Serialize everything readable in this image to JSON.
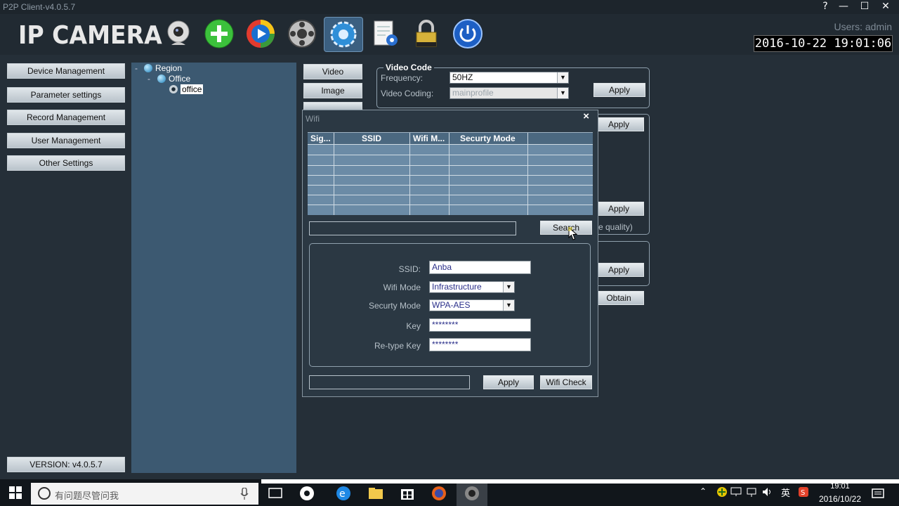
{
  "window": {
    "title": "P2P Client-v4.0.5.7",
    "controls": [
      "?",
      "—",
      "☐",
      "✕"
    ]
  },
  "header": {
    "logo": "IP CAMERA",
    "toolbar_icons": [
      "webcam-icon",
      "add-icon",
      "playback-icon",
      "ptz-wheel-icon",
      "settings-gear-icon",
      "log-icon",
      "lock-icon",
      "power-icon"
    ],
    "active_tool": "settings-gear-icon",
    "users": "Users: admin",
    "datetime": "2016-10-22 19:01:06"
  },
  "sidebar": {
    "items": [
      {
        "label": "Device Management"
      },
      {
        "label": "Parameter settings"
      },
      {
        "label": "Record Management"
      },
      {
        "label": "User Management"
      },
      {
        "label": "Other Settings"
      }
    ],
    "version": "VERSION: v4.0.5.7"
  },
  "tree": {
    "toggles": [
      "-",
      "-"
    ],
    "nodes": [
      {
        "label": "Region"
      },
      {
        "label": "Office"
      },
      {
        "label": "office",
        "selected": true
      }
    ]
  },
  "param_tabs": [
    "Video",
    "Image"
  ],
  "video_code": {
    "title": "Video Code",
    "frequency_label": "Frequency:",
    "frequency_value": "50HZ",
    "coding_label": "Video Coding:",
    "coding_value": "mainprofile",
    "apply": "Apply"
  },
  "background_panel": {
    "apply_buttons": [
      "Apply",
      "Apply",
      "Apply"
    ],
    "quality_fragment": "e quality)",
    "obtain": "Obtain"
  },
  "wifi_dialog": {
    "caption": "Wifi",
    "close": "×",
    "columns": [
      "Sig...",
      "SSID",
      "Wifi M...",
      "Securty Mode"
    ],
    "search_button": "Search",
    "ssid_label": "SSID:",
    "ssid_value": "Anba",
    "wifi_mode_label": "Wifi Mode",
    "wifi_mode_value": "Infrastructure",
    "security_label": "Securty Mode",
    "security_value": "WPA-AES",
    "key_label": "Key",
    "key_value": "********",
    "retype_label": "Re-type Key",
    "retype_value": "********",
    "apply": "Apply",
    "wifi_check": "Wifi Check"
  },
  "taskbar": {
    "search_placeholder": "有问题尽管问我",
    "tray_lang": "英",
    "time": "19:01",
    "date": "2016/10/22"
  }
}
